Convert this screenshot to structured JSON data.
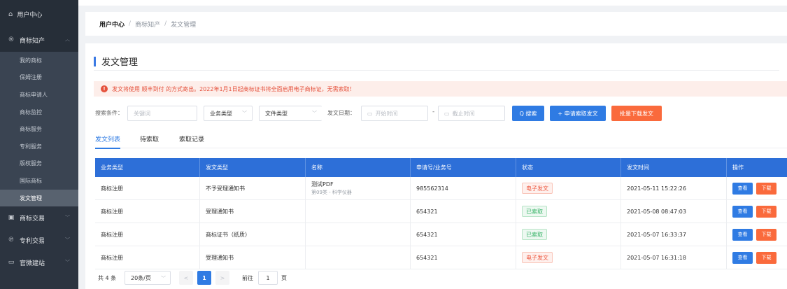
{
  "sidebar": {
    "top_label": "用户中心",
    "group_open": "商标知产",
    "sub_items": [
      "我的商标",
      "保姆注册",
      "商标申请人",
      "商标监控",
      "商标服务",
      "专利服务",
      "版权服务",
      "国际商标",
      "发文管理"
    ],
    "active_sub": "发文管理",
    "collapsed": [
      {
        "label": "商标交易"
      },
      {
        "label": "专利交易"
      },
      {
        "label": "官微建站"
      }
    ]
  },
  "breadcrumb": {
    "current": "用户中心",
    "sep": "/",
    "links": [
      "商标知产",
      "发文管理"
    ]
  },
  "page": {
    "title": "发文管理",
    "notice_icon": "!",
    "notice": "发文将使用 顺丰到付 的方式寄出。2022年1月1日起商标证书将全面启用电子商标证，无需索取！"
  },
  "search": {
    "label": "搜索条件：",
    "keyword_placeholder": "关键词",
    "biz_type": "业务类型",
    "file_type": "文件类型",
    "date_label": "发文日期：",
    "start_placeholder": "开始时间",
    "end_placeholder": "截止时间",
    "range_sep": "-",
    "search_btn": "Q 搜索",
    "apply_btn": "+ 申请索取发文",
    "batch_btn": "批量下载发文"
  },
  "tabs": [
    "发文列表",
    "待索取",
    "索取记录"
  ],
  "table": {
    "headers": [
      "业务类型",
      "发文类型",
      "名称",
      "申请号/业务号",
      "状态",
      "发文时间",
      "操作"
    ],
    "rows": [
      {
        "biz": "商标注册",
        "doc": "不予受理通知书",
        "name": "测试PDF",
        "name_sub": "第09类 - 科学仪器",
        "no": "985562314",
        "status": "电子发文",
        "status_type": "red",
        "time": "2021-05-11 15:22:26"
      },
      {
        "biz": "商标注册",
        "doc": "受理通知书",
        "name": "",
        "name_sub": "",
        "no": "654321",
        "status": "已索取",
        "status_type": "green",
        "time": "2021-05-08 08:47:03"
      },
      {
        "biz": "商标注册",
        "doc": "商标证书（纸质）",
        "name": "",
        "name_sub": "",
        "no": "654321",
        "status": "已索取",
        "status_type": "green",
        "time": "2021-05-07 16:33:37"
      },
      {
        "biz": "商标注册",
        "doc": "受理通知书",
        "name": "",
        "name_sub": "",
        "no": "654321",
        "status": "电子发文",
        "status_type": "red",
        "time": "2021-05-07 16:31:18"
      }
    ],
    "view_label": "查看",
    "download_label": "下载"
  },
  "pager": {
    "total": "共 4 条",
    "size": "20条/页",
    "prev": "<",
    "current": "1",
    "next": ">",
    "goto": "前往",
    "goto_value": "1",
    "unit": "页"
  },
  "colors": {
    "accent": "#2f7be3",
    "orange": "#fa6a3c",
    "sidebar": "#2c3440"
  }
}
